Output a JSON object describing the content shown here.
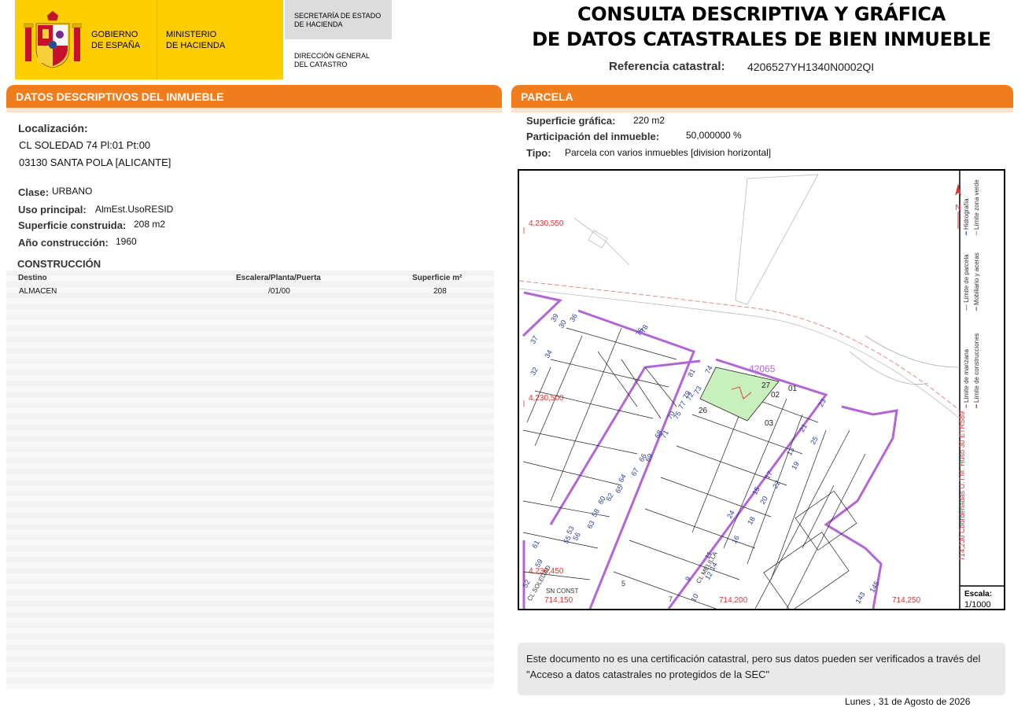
{
  "header": {
    "gov_line1": "GOBIERNO",
    "gov_line2": "DE ESPAÑA",
    "min_line1": "MINISTERIO",
    "min_line2": "DE HACIENDA",
    "sec_line1": "SECRETARÍA DE ESTADO",
    "sec_line2": "DE HACIENDA",
    "dg_line1": "DIRECCIÓN GENERAL",
    "dg_line2": "DEL CATASTRO",
    "title_line1": "CONSULTA DESCRIPTIVA Y GRÁFICA",
    "title_line2": "DE DATOS CATASTRALES DE BIEN INMUEBLE",
    "ref_label": "Referencia catastral:",
    "ref_value": "4206527YH1340N0002QI"
  },
  "descriptive": {
    "section_title": "DATOS DESCRIPTIVOS DEL INMUEBLE",
    "localizacion_label": "Localización:",
    "address_line1": "CL SOLEDAD 74 Pl:01 Pt:00",
    "address_line2": "03130 SANTA POLA [ALICANTE]",
    "clase_label": "Clase:",
    "clase_value": "URBANO",
    "uso_label": "Uso principal:",
    "uso_value": "AlmEst.UsoRESID",
    "superficie_label": "Superficie construida:",
    "superficie_value": "208 m2",
    "anio_label": "Año construcción:",
    "anio_value": "1960",
    "construccion_title": "CONSTRUCCIÓN",
    "table": {
      "headers": [
        "Destino",
        "Escalera/Planta/Puerta",
        "Superficie m²"
      ],
      "rows": [
        [
          "ALMACEN",
          "/01/00",
          "208"
        ]
      ]
    }
  },
  "parcela": {
    "section_title": "PARCELA",
    "sup_label": "Superficie gráfica:",
    "sup_value": "220 m2",
    "part_label": "Participación del inmueble:",
    "part_value": "50,000000 %",
    "tipo_label": "Tipo:",
    "tipo_value": "Parcela con varios inmuebles [division horizontal]"
  },
  "map": {
    "coord_y1": "4,230,550",
    "coord_y2": "4,230,500",
    "coord_y3": "4,230,450",
    "coord_x1": "714,150",
    "coord_x2": "714,200",
    "coord_x3": "714,250",
    "parcel_id": "42065",
    "sn_const": "SN CONST",
    "street1": "CL MELILLA",
    "street2": "CL SOLEDAD",
    "legend_1": "Límite de manzana",
    "legend_2": "Límite de parcela",
    "legend_3": "Hidrografía",
    "legend_4": "Límite de construcciones",
    "legend_5": "Mobiliario y aceras",
    "legend_6": "Límite zona verde",
    "legend_coords": "714,230 Coordenadas U.T.M. Huso 30 ETRS89",
    "scale_label": "Escala:",
    "scale_value": "1/1000",
    "labels": [
      "27",
      "01",
      "02",
      "03",
      "26",
      "74",
      "72",
      "73",
      "75",
      "77",
      "79",
      "81",
      "69",
      "71",
      "65",
      "67",
      "63",
      "61",
      "59",
      "62",
      "64",
      "66",
      "68",
      "70",
      "56",
      "58",
      "60",
      "52",
      "55",
      "53",
      "34",
      "32",
      "30",
      "36",
      "37",
      "39",
      "76",
      "78",
      "21",
      "23",
      "25",
      "13",
      "17",
      "19",
      "15",
      "20",
      "22",
      "24",
      "9",
      "11",
      "5",
      "7",
      "10",
      "12",
      "14",
      "16",
      "18",
      "143",
      "145"
    ]
  },
  "note": {
    "text": "Este documento no es una certificación catastral, pero sus datos pueden ser verificados a través del \"Acceso a datos catastrales no protegidos de la SEC\""
  },
  "footer": {
    "date": "Lunes , 31 de Agosto de 2026"
  },
  "colors": {
    "orange": "#f07d1c",
    "yellow": "#ffce00",
    "purple": "#b266d6",
    "green_parcel": "#c8f0bd"
  }
}
